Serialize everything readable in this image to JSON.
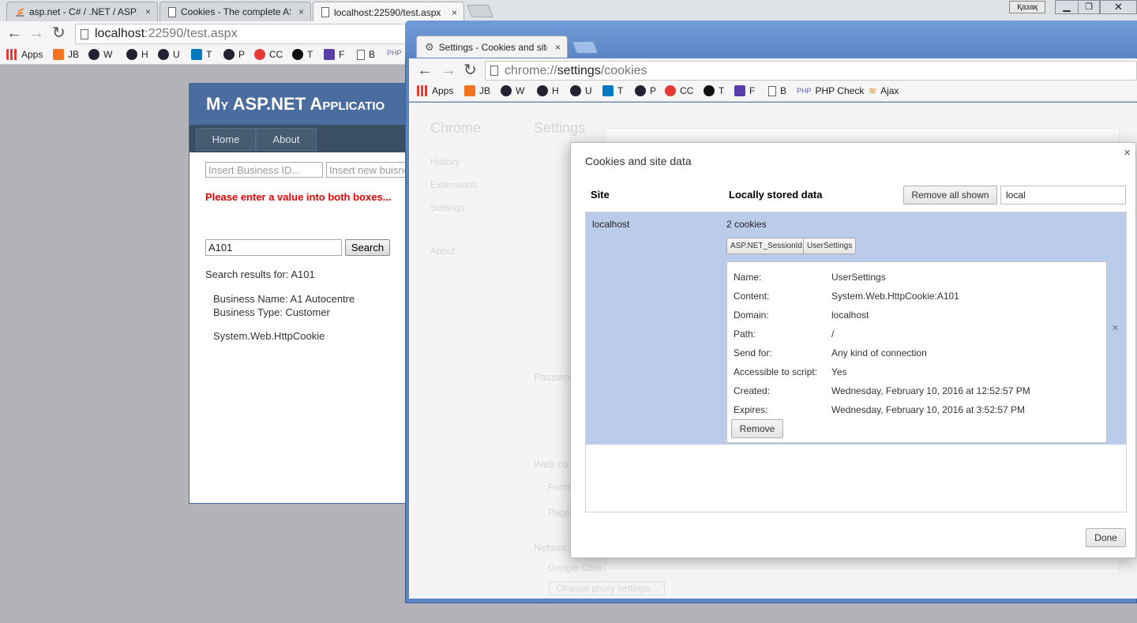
{
  "bg_browser": {
    "tabs": [
      {
        "title": "asp.net - C# / .NET / ASPX",
        "close": "×"
      },
      {
        "title": "Cookies - The complete AS",
        "close": "×"
      },
      {
        "title": "localhost:22590/test.aspx",
        "close": "×"
      }
    ],
    "window_user_badge": "Қазақ",
    "address": {
      "host": "localhost",
      "path": ":22590/test.aspx"
    },
    "bookmarks": [
      "Apps",
      "JB",
      "W",
      "H",
      "U",
      "T",
      "P",
      "CC",
      "T",
      "F",
      "B",
      "P"
    ]
  },
  "asp_page": {
    "title": "My ASP.NET Applicatio",
    "menu": [
      "Home",
      "About"
    ],
    "business_id_placeholder": "Insert Business ID...",
    "business_name_placeholder": "Insert new buisne",
    "error": "Please enter a value into both boxes...",
    "search_value": "A101",
    "search_button": "Search",
    "results_label": "Search results for: A101",
    "business_name": "Business Name: A1 Autocentre",
    "business_type": "Business Type: Customer",
    "cookie_text": "System.Web.HttpCookie"
  },
  "settings_window": {
    "tab_title": "Settings - Cookies and site",
    "tab_close": "×",
    "address": {
      "scheme": "chrome://",
      "host": "settings",
      "path": "/cookies"
    },
    "bookmarks": [
      "Apps",
      "JB",
      "W",
      "H",
      "U",
      "T",
      "P",
      "CC",
      "T",
      "F",
      "B",
      "PHP Check",
      "Ajax"
    ],
    "faded_page": {
      "brand": "Chrome",
      "heading": "Settings",
      "nav": [
        "History",
        "Extensions",
        "Settings",
        "About"
      ],
      "sections": [
        "Passwo",
        "Web co",
        "Networ"
      ],
      "items": [
        "Form",
        "Page",
        "Google Chro",
        "Change proxy settings..."
      ]
    }
  },
  "cookies_dialog": {
    "title": "Cookies and site data",
    "close": "×",
    "col_site": "Site",
    "col_data": "Locally stored data",
    "remove_all_button": "Remove all shown",
    "search_value": "local",
    "row": {
      "site": "localhost",
      "summary": "2 cookies",
      "cookies": [
        "ASP.NET_SessionId",
        "UserSettings"
      ],
      "remove_row": "×"
    },
    "details": {
      "labels": [
        "Name:",
        "Content:",
        "Domain:",
        "Path:",
        "Send for:",
        "Accessible to script:",
        "Created:",
        "Expires:"
      ],
      "values": [
        "UserSettings",
        "System.Web.HttpCookie:A101",
        "localhost",
        "/",
        "Any kind of connection",
        "Yes",
        "Wednesday, February 10, 2016 at 12:52:57 PM",
        "Wednesday, February 10, 2016 at 3:52:57 PM"
      ],
      "remove_button": "Remove"
    },
    "done_button": "Done"
  },
  "colors": {
    "asp_header": "#4b6c9e",
    "error_text": "#ee0000",
    "selected_row": "#bbccea",
    "window_frame": "#5b86c6"
  }
}
